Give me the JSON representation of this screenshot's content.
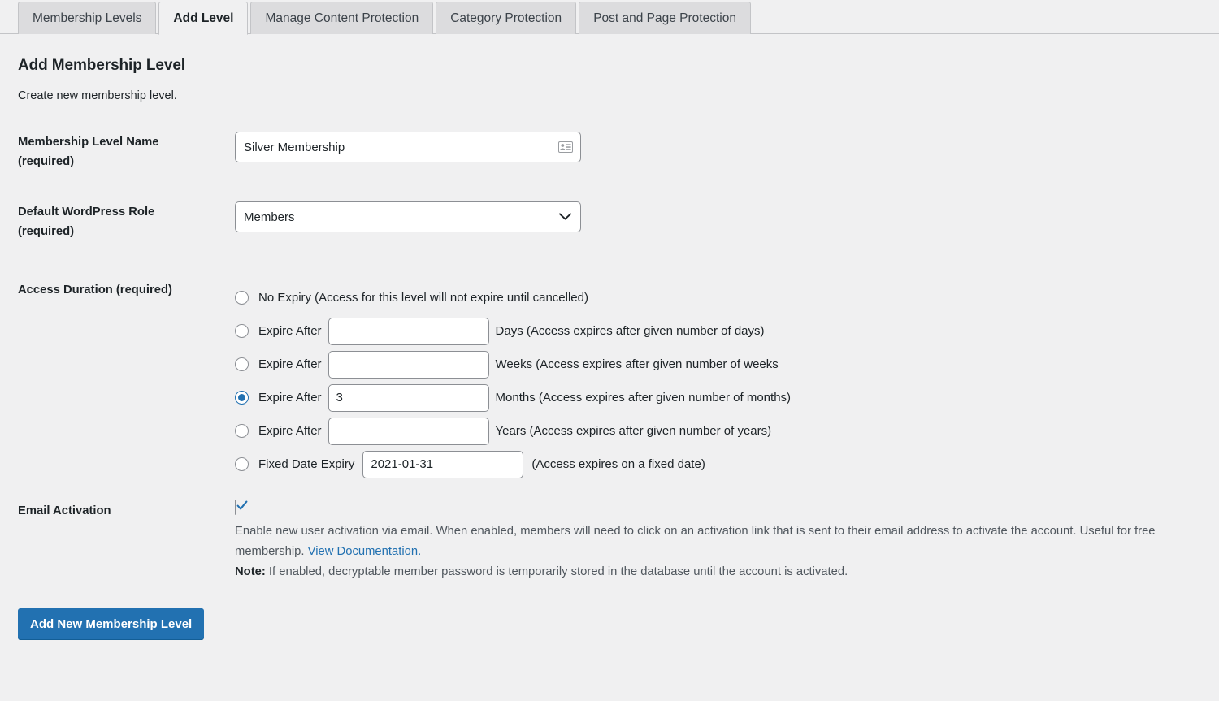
{
  "tabs": [
    {
      "label": "Membership Levels",
      "active": false
    },
    {
      "label": "Add Level",
      "active": true
    },
    {
      "label": "Manage Content Protection",
      "active": false
    },
    {
      "label": "Category Protection",
      "active": false
    },
    {
      "label": "Post and Page Protection",
      "active": false
    }
  ],
  "page": {
    "title": "Add Membership Level",
    "subtitle": "Create new membership level."
  },
  "fields": {
    "level_name": {
      "label_line1": "Membership Level Name",
      "label_line2": "(required)",
      "value": "Silver Membership",
      "icon": "contact-card-icon"
    },
    "wp_role": {
      "label_line1": "Default WordPress Role",
      "label_line2": "(required)",
      "value": "Members",
      "icon": "chevron-down-icon",
      "options": [
        "Members"
      ]
    },
    "access_duration": {
      "label": "Access Duration (required)",
      "options": [
        {
          "id": "no-expiry",
          "selected": false,
          "lead": "No Expiry (Access for this level will not expire until cancelled)",
          "has_input": false,
          "input_value": "",
          "trail": ""
        },
        {
          "id": "expire-days",
          "selected": false,
          "lead": "Expire After",
          "has_input": true,
          "input_value": "",
          "trail": "Days (Access expires after given number of days)"
        },
        {
          "id": "expire-weeks",
          "selected": false,
          "lead": "Expire After",
          "has_input": true,
          "input_value": "",
          "trail": "Weeks (Access expires after given number of weeks"
        },
        {
          "id": "expire-months",
          "selected": true,
          "lead": "Expire After",
          "has_input": true,
          "input_value": "3",
          "trail": "Months (Access expires after given number of months)"
        },
        {
          "id": "expire-years",
          "selected": false,
          "lead": "Expire After",
          "has_input": true,
          "input_value": "",
          "trail": "Years (Access expires after given number of years)"
        },
        {
          "id": "fixed-date",
          "selected": false,
          "lead": "Fixed Date Expiry",
          "has_input": true,
          "input_value": "2021-01-31",
          "trail": "(Access expires on a fixed date)"
        }
      ]
    },
    "email_activation": {
      "label": "Email Activation",
      "checked": true,
      "description_before_link": "Enable new user activation via email. When enabled, members will need to click on an activation link that is sent to their email address to activate the account. Useful for free membership. ",
      "link_text": "View Documentation.",
      "note_label": "Note:",
      "note_text": " If enabled, decryptable member password is temporarily stored in the database until the account is activated."
    }
  },
  "submit": {
    "label": "Add New Membership Level"
  },
  "colors": {
    "accent": "#2271b1",
    "background": "#f0f0f1",
    "border": "#8c8f94",
    "tab_inactive": "#dcdcde"
  }
}
